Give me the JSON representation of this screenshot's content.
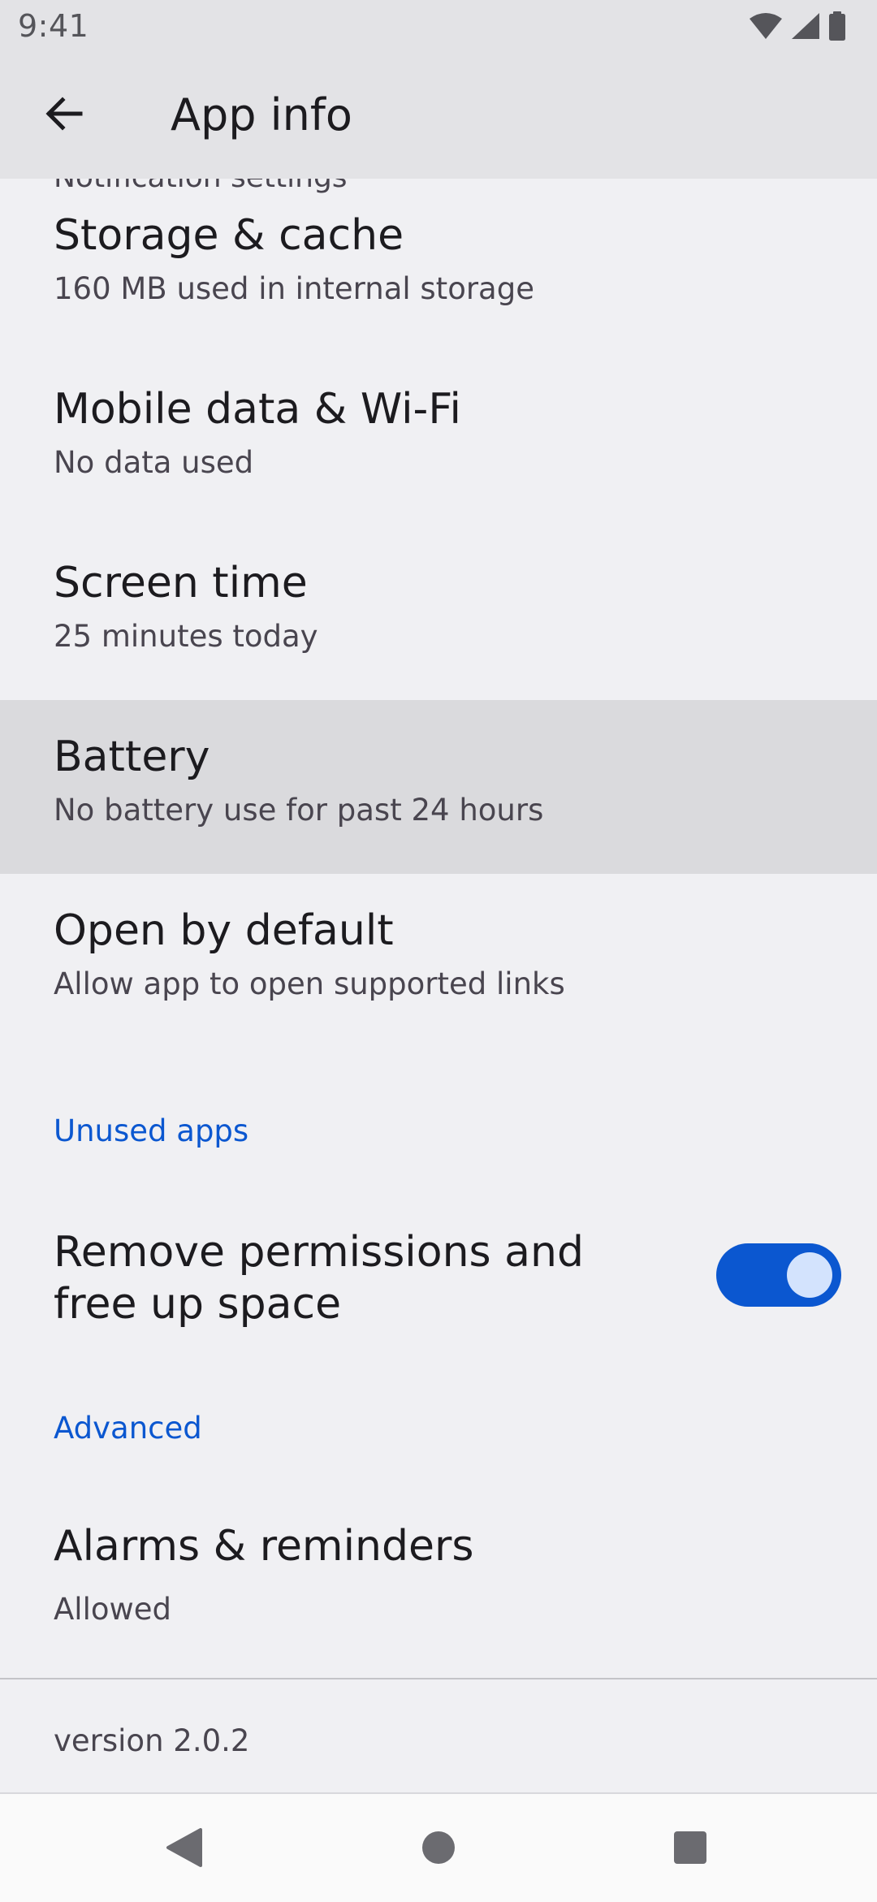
{
  "status_bar": {
    "time": "9:41",
    "icons": [
      "wifi-icon",
      "cellular-signal-icon",
      "battery-icon"
    ]
  },
  "app_bar": {
    "title": "App info",
    "back_icon": "arrow-back-icon"
  },
  "list": {
    "clipped_item_subtitle": "Notification settings",
    "items": [
      {
        "title": "Storage & cache",
        "subtitle": "160 MB used in internal storage"
      },
      {
        "title": "Mobile data & Wi-Fi",
        "subtitle": "No data used"
      },
      {
        "title": "Screen time",
        "subtitle": "25 minutes today"
      },
      {
        "title": "Battery",
        "subtitle": "No battery use for past 24 hours"
      },
      {
        "title": "Open by default",
        "subtitle": "Allow app to open supported links"
      }
    ]
  },
  "unused_apps": {
    "header": "Unused apps",
    "toggle_label": "Remove permissions and free up space",
    "toggle_on": true
  },
  "advanced": {
    "header": "Advanced",
    "items": [
      {
        "title": "Alarms & reminders",
        "subtitle": "Allowed"
      }
    ]
  },
  "footer": {
    "version": "version 2.0.2"
  },
  "nav_bar": {
    "buttons": [
      "back-triangle-icon",
      "home-circle-icon",
      "recents-square-icon"
    ]
  },
  "colors": {
    "accent": "#0b57d0",
    "background": "#f0f0f3",
    "app_bar": "#e3e3e6",
    "highlight_row": "#dadadd"
  }
}
